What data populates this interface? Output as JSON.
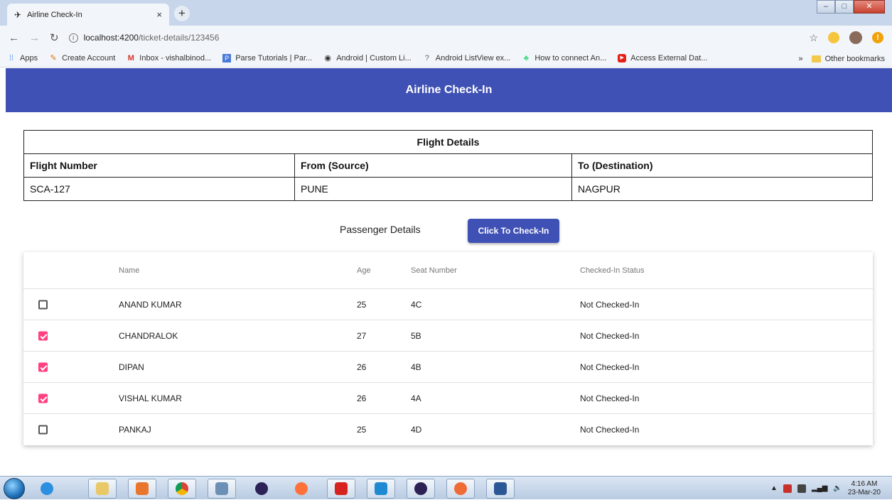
{
  "browser": {
    "tab_title": "Airline Check-In",
    "tab_close": "×",
    "new_tab": "+",
    "url_host": "localhost:4200",
    "url_path": "/ticket-details/123456",
    "bookmarks": [
      {
        "label": "Apps",
        "icon": "apps-grid-icon"
      },
      {
        "label": "Create Account",
        "icon": "create-account-icon"
      },
      {
        "label": "Inbox - vishalbinod...",
        "icon": "gmail-icon"
      },
      {
        "label": "Parse Tutorials | Par...",
        "icon": "parse-icon"
      },
      {
        "label": "Android | Custom Li...",
        "icon": "globe-icon"
      },
      {
        "label": "Android ListView ex...",
        "icon": "question-icon"
      },
      {
        "label": "How to connect An...",
        "icon": "android-icon"
      },
      {
        "label": "Access External Dat...",
        "icon": "youtube-icon"
      }
    ],
    "more_bookmarks": "»",
    "other_bookmarks": "Other bookmarks"
  },
  "app": {
    "title": "Airline Check-In",
    "flight": {
      "caption": "Flight Details",
      "headers": [
        "Flight Number",
        "From (Source)",
        "To (Destination)"
      ],
      "values": [
        "SCA-127",
        "PUNE",
        "NAGPUR"
      ]
    },
    "passenger_title": "Passenger Details",
    "checkin_button": "Click To Check-In",
    "columns": {
      "name": "Name",
      "age": "Age",
      "seat": "Seat Number",
      "status": "Checked-In Status"
    },
    "passengers": [
      {
        "name": "ANAND KUMAR",
        "age": "25",
        "seat": "4C",
        "status": "Not Checked-In",
        "selected": false
      },
      {
        "name": "CHANDRALOK",
        "age": "27",
        "seat": "5B",
        "status": "Not Checked-In",
        "selected": true
      },
      {
        "name": "DIPAN",
        "age": "26",
        "seat": "4B",
        "status": "Not Checked-In",
        "selected": true
      },
      {
        "name": "VISHAL KUMAR",
        "age": "26",
        "seat": "4A",
        "status": "Not Checked-In",
        "selected": true
      },
      {
        "name": "PANKAJ",
        "age": "25",
        "seat": "4D",
        "status": "Not Checked-In",
        "selected": false
      }
    ],
    "colors": {
      "primary": "#3f51b5",
      "accent": "#ff4081"
    }
  },
  "taskbar": {
    "time": "4:16 AM",
    "date": "23-Mar-20",
    "apps": [
      "internet-explorer-icon",
      "file-explorer-icon",
      "outlook-icon",
      "chrome-icon",
      "virtualbox-icon",
      "eclipse-icon",
      "firefox-icon",
      "acrobat-icon",
      "vscode-icon",
      "eclipse-icon",
      "postman-icon",
      "word-icon"
    ]
  }
}
